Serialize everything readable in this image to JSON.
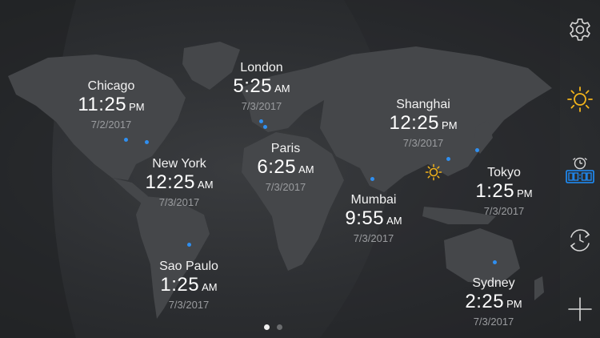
{
  "cities": [
    {
      "key": "chicago",
      "name": "Chicago",
      "time": "11:25",
      "ampm": "PM",
      "date": "7/2/2017"
    },
    {
      "key": "london",
      "name": "London",
      "time": "5:25",
      "ampm": "AM",
      "date": "7/3/2017"
    },
    {
      "key": "shanghai",
      "name": "Shanghai",
      "time": "12:25",
      "ampm": "PM",
      "date": "7/3/2017"
    },
    {
      "key": "new-york",
      "name": "New York",
      "time": "12:25",
      "ampm": "AM",
      "date": "7/3/2017"
    },
    {
      "key": "paris",
      "name": "Paris",
      "time": "6:25",
      "ampm": "AM",
      "date": "7/3/2017"
    },
    {
      "key": "tokyo",
      "name": "Tokyo",
      "time": "1:25",
      "ampm": "PM",
      "date": "7/3/2017"
    },
    {
      "key": "mumbai",
      "name": "Mumbai",
      "time": "9:55",
      "ampm": "AM",
      "date": "7/3/2017"
    },
    {
      "key": "sao-paulo",
      "name": "Sao Paulo",
      "time": "1:25",
      "ampm": "AM",
      "date": "7/3/2017"
    },
    {
      "key": "sydney",
      "name": "Sydney",
      "time": "2:25",
      "ampm": "PM",
      "date": "7/3/2017"
    }
  ],
  "sidebar": {
    "buttons": [
      "gear-icon",
      "sun-icon",
      "digital-clock-icon",
      "clock-sync-icon",
      "plus-icon"
    ]
  },
  "pager": {
    "pages": 2,
    "active": 0
  },
  "colors": {
    "background": "#2c2e31",
    "land": "#45474a",
    "night_shadow": "#1f2123",
    "dot": "#2f8ff0",
    "sun": "#f3b41b",
    "digital_clock": "#1e90ff",
    "icon": "#d8d8d8",
    "date_text": "#9a9c9f"
  }
}
